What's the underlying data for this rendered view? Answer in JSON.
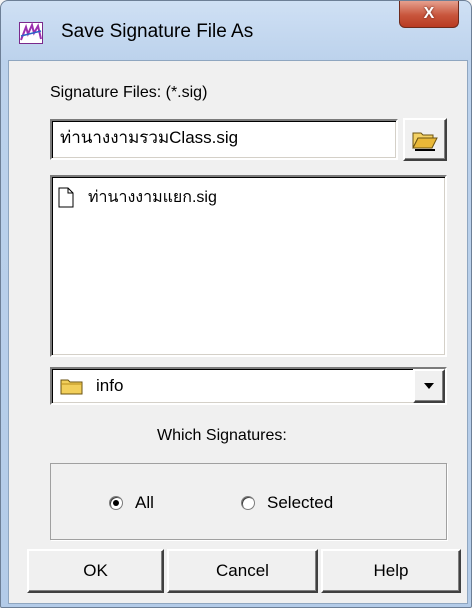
{
  "window": {
    "title": "Save Signature File As",
    "close_glyph": "X"
  },
  "signature_files_label": "Signature Files: (*.sig)",
  "filename_input": {
    "value": "ท่านางงามรวมClass.sig"
  },
  "file_list": [
    {
      "name": "ท่านางงามแยก.sig",
      "icon": "document-icon"
    }
  ],
  "folder_combo": {
    "selected": "info",
    "icon": "folder-icon"
  },
  "which_signatures_label": "Which Signatures:",
  "radio_options": [
    {
      "label": "All",
      "checked": true
    },
    {
      "label": "Selected",
      "checked": false
    }
  ],
  "buttons": {
    "ok": "OK",
    "cancel": "Cancel",
    "help": "Help"
  },
  "colors": {
    "title_bar": "#bcd2ec",
    "close_button": "#c8553c",
    "dialog_face": "#f0f0f0"
  }
}
